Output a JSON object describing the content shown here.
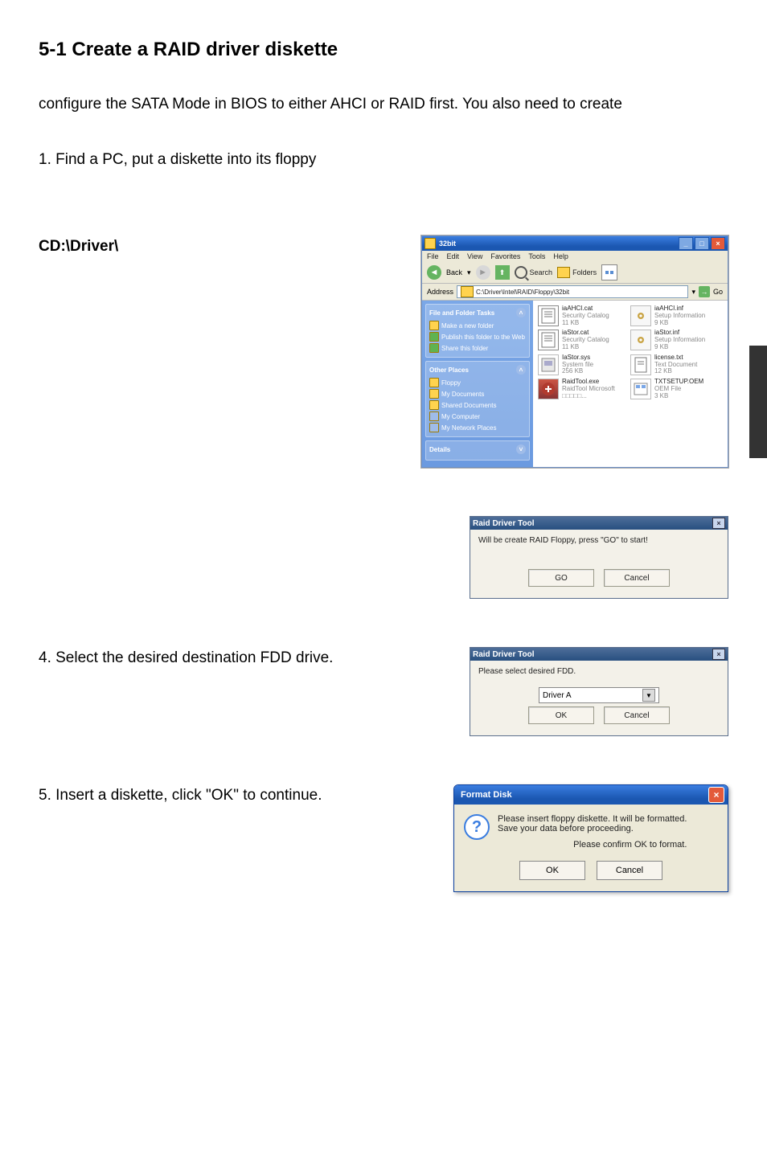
{
  "heading": "5-1 Create a RAID driver diskette",
  "intro": "configure the SATA Mode in BIOS to either AHCI or RAID first. You also need to create",
  "step1": "1. Find a PC, put a diskette into its floppy",
  "cd_path_label": "CD:\\Driver\\",
  "step4": "4. Select the desired destination FDD drive.",
  "step5": "5. Insert a diskette, click \"OK\" to continue.",
  "explorer": {
    "title": "32bit",
    "menu": [
      "File",
      "Edit",
      "View",
      "Favorites",
      "Tools",
      "Help"
    ],
    "back": "Back",
    "search": "Search",
    "folders": "Folders",
    "address_label": "Address",
    "address_value": "C:\\Driver\\Intel\\RAID\\Floppy\\32bit",
    "go": "Go",
    "side_tasks_hdr": "File and Folder Tasks",
    "side_tasks": [
      "Make a new folder",
      "Publish this folder to the Web",
      "Share this folder"
    ],
    "side_places_hdr": "Other Places",
    "side_places": [
      "Floppy",
      "My Documents",
      "Shared Documents",
      "My Computer",
      "My Network Places"
    ],
    "side_details_hdr": "Details",
    "files": [
      {
        "name": "iaAHCI.cat",
        "sub": "Security Catalog",
        "size": "11 KB",
        "icon": "notepad"
      },
      {
        "name": "iaAHCI.inf",
        "sub": "Setup Information",
        "size": "9 KB",
        "icon": "gear"
      },
      {
        "name": "iaStor.cat",
        "sub": "Security Catalog",
        "size": "11 KB",
        "icon": "notepad"
      },
      {
        "name": "iaStor.inf",
        "sub": "Setup Information",
        "size": "9 KB",
        "icon": "gear"
      },
      {
        "name": "IaStor.sys",
        "sub": "System file",
        "size": "256 KB",
        "icon": "sys"
      },
      {
        "name": "license.txt",
        "sub": "Text Document",
        "size": "12 KB",
        "icon": "txt"
      },
      {
        "name": "RaidTool.exe",
        "sub": "RaidTool Microsoft □□□□□...",
        "size": "",
        "icon": "exe"
      },
      {
        "name": "TXTSETUP.OEM",
        "sub": "OEM File",
        "size": "3 KB",
        "icon": "oem"
      }
    ]
  },
  "dlg_go": {
    "title": "Raid Driver Tool",
    "msg": "Will be create RAID Floppy, press \"GO\" to start!",
    "go_btn": "GO",
    "cancel_btn": "Cancel"
  },
  "dlg_fdd": {
    "title": "Raid Driver Tool",
    "msg": "Please select desired FDD.",
    "dd_value": "Driver A",
    "ok_btn": "OK",
    "cancel_btn": "Cancel"
  },
  "dlg_fmt": {
    "title": "Format Disk",
    "line1": "Please insert floppy diskette.  It will be formatted.\nSave your data before proceeding.",
    "line2": "Please confirm OK to format.",
    "ok_btn": "OK",
    "cancel_btn": "Cancel"
  }
}
